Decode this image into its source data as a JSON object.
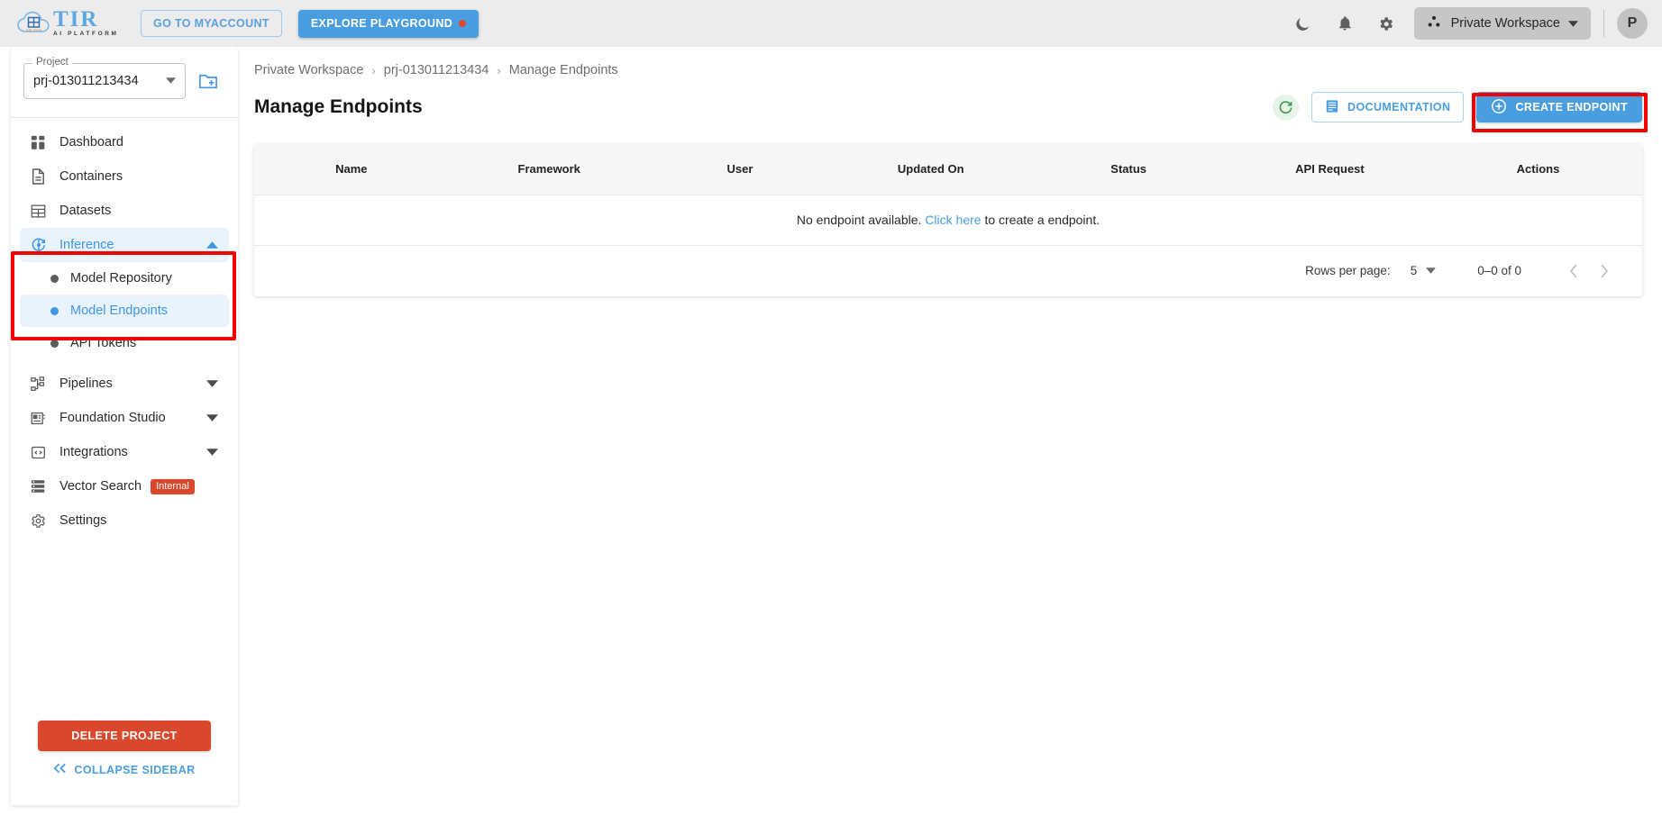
{
  "topbar": {
    "logo": {
      "title": "TIR",
      "subtitle": "AI PLATFORM",
      "icon": "cloud-logo-icon"
    },
    "myaccount_label": "GO TO MYACCOUNT",
    "playground_label": "EXPLORE PLAYGROUND",
    "icons": {
      "dark_mode": "moon-icon",
      "notifications": "bell-icon",
      "settings": "gear-icon",
      "workspace": "workspace-nodes-icon"
    },
    "workspace_label": "Private Workspace",
    "avatar_initial": "P"
  },
  "sidebar": {
    "project_legend": "Project",
    "project_value": "prj-013011213434",
    "new_project_icon": "new-folder-icon",
    "items": [
      {
        "label": "Dashboard",
        "icon": "dashboard-icon",
        "type": "link",
        "active": false
      },
      {
        "label": "Containers",
        "icon": "document-icon",
        "type": "link",
        "active": false
      },
      {
        "label": "Datasets",
        "icon": "grid-table-icon",
        "type": "link",
        "active": false
      },
      {
        "label": "Inference",
        "icon": "inference-icon",
        "type": "expanded",
        "active": true,
        "caret": "chevron-up-icon"
      },
      {
        "label": "Pipelines",
        "icon": "pipelines-icon",
        "type": "collapsed",
        "active": false,
        "caret": "chevron-down-icon"
      },
      {
        "label": "Foundation Studio",
        "icon": "foundation-studio-icon",
        "type": "collapsed",
        "active": false,
        "caret": "chevron-down-icon"
      },
      {
        "label": "Integrations",
        "icon": "code-brackets-icon",
        "type": "collapsed",
        "active": false,
        "caret": "chevron-down-icon"
      },
      {
        "label": "Vector Search",
        "icon": "list-rows-icon",
        "type": "link",
        "active": false,
        "badge": "Internal"
      },
      {
        "label": "Settings",
        "icon": "gear-icon",
        "type": "link",
        "active": false
      }
    ],
    "inference_children": [
      {
        "label": "Model Repository",
        "active": false
      },
      {
        "label": "Model Endpoints",
        "active": true
      },
      {
        "label": "API Tokens",
        "active": false
      }
    ],
    "delete_project_label": "DELETE PROJECT",
    "collapse_label": "COLLAPSE SIDEBAR",
    "collapse_icon": "chevrons-left-icon"
  },
  "main": {
    "breadcrumb": [
      "Private Workspace",
      "prj-013011213434",
      "Manage Endpoints"
    ],
    "breadcrumb_separator": "›",
    "page_title": "Manage Endpoints",
    "refresh_icon": "refresh-icon",
    "documentation_label": "DOCUMENTATION",
    "documentation_icon": "book-icon",
    "create_label": "CREATE ENDPOINT",
    "create_icon": "plus-circle-icon",
    "table": {
      "columns": [
        "Name",
        "Framework",
        "User",
        "Updated On",
        "Status",
        "API Request",
        "Actions"
      ],
      "rows": [],
      "empty_message_before": "No endpoint available. ",
      "empty_link": "Click here",
      "empty_message_after": " to create a endpoint."
    },
    "pagination": {
      "rows_per_page_label": "Rows per page:",
      "rows_per_page_value": "5",
      "range_label": "0–0 of 0",
      "prev_icon": "chevron-left-icon",
      "next_icon": "chevron-right-icon"
    }
  },
  "colors": {
    "accent_blue": "#4a9ee0",
    "danger_red": "#d9482c",
    "annotation_red": "#f50000",
    "refresh_green": "#3f9a50",
    "header_gray": "#ececec"
  },
  "annotations": [
    {
      "name": "inference-menu-highlight",
      "target": "sidebar-inference-group"
    },
    {
      "name": "create-endpoint-highlight",
      "target": "create-endpoint-button"
    }
  ]
}
